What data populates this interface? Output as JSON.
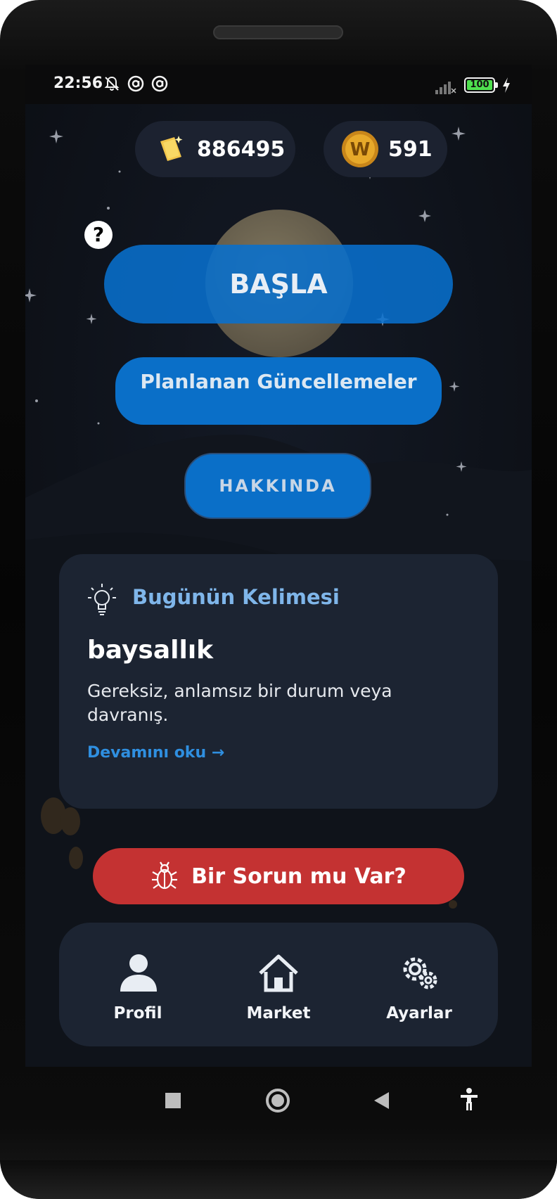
{
  "status_bar": {
    "time": "22:56",
    "battery": "100",
    "icons": [
      "bell-muted-icon",
      "circle-a-icon",
      "circle-a-icon",
      "signal-icon",
      "battery-icon",
      "charging-icon"
    ]
  },
  "currency": {
    "tickets": "886495",
    "coins": "591",
    "coin_letter": "W"
  },
  "help_label": "?",
  "buttons": {
    "start": "BAŞLA",
    "planned_updates": "Planlanan Güncellemeler",
    "about": "HAKKINDA",
    "report": "Bir Sorun mu Var?"
  },
  "word_of_day": {
    "title": "Bugünün Kelimesi",
    "word": "baysallık",
    "definition": "Gereksiz, anlamsız bir durum veya davranış.",
    "read_more": "Devamını oku →"
  },
  "bottom_nav": {
    "profile": "Profil",
    "market": "Market",
    "settings": "Ayarlar"
  },
  "colors": {
    "primary_button": "#0a6fc8",
    "danger_button": "#c43232",
    "card_bg": "#1c2432",
    "accent_text": "#7fb6ea",
    "link": "#2f8fe0"
  }
}
